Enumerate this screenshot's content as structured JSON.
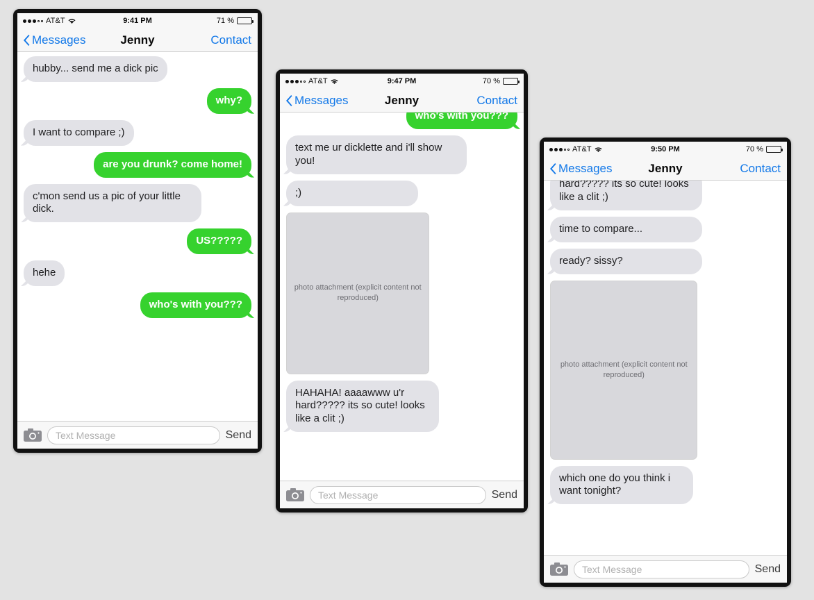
{
  "background_color": "#e3e3e3",
  "colors": {
    "bubble_incoming": "#e2e2e7",
    "bubble_outgoing": "#36d22e",
    "link_blue": "#1278e8",
    "chrome_gray": "#f7f7f7"
  },
  "phones": [
    {
      "id": "phone-1",
      "status_bar": {
        "carrier": "AT&T",
        "signal_dots_filled": 3,
        "signal_dots_hollow": 2,
        "wifi_icon": "wifi-icon",
        "time": "9:41 PM",
        "battery_percent": "71 %",
        "battery_level": 71
      },
      "nav": {
        "back_icon": "chevron-left-icon",
        "back_label": "Messages",
        "title": "Jenny",
        "right_label": "Contact"
      },
      "messages": [
        {
          "side": "in",
          "text": "hubby... send me a dick pic"
        },
        {
          "side": "out",
          "text": "why?"
        },
        {
          "side": "in",
          "text": "I want to compare ;)"
        },
        {
          "side": "out",
          "text": "are you drunk? come home!"
        },
        {
          "side": "in",
          "text": "c'mon send us a pic of your little dick."
        },
        {
          "side": "out",
          "text": "US?????"
        },
        {
          "side": "in",
          "text": "hehe"
        },
        {
          "side": "out",
          "text": "who's with you???"
        }
      ],
      "composer": {
        "camera_icon": "camera-icon",
        "placeholder": "Text Message",
        "send_label": "Send"
      }
    },
    {
      "id": "phone-2",
      "status_bar": {
        "carrier": "AT&T",
        "signal_dots_filled": 3,
        "signal_dots_hollow": 2,
        "wifi_icon": "wifi-icon",
        "time": "9:47 PM",
        "battery_percent": "70 %",
        "battery_level": 70
      },
      "nav": {
        "back_icon": "chevron-left-icon",
        "back_label": "Messages",
        "title": "Jenny",
        "right_label": "Contact"
      },
      "messages": [
        {
          "side": "out",
          "text": "who's with you???",
          "clipped": true
        },
        {
          "side": "in",
          "text": "text me ur dicklette and i'll show you!"
        },
        {
          "side": "in",
          "text": ";)"
        },
        {
          "side": "in",
          "type": "photo",
          "text": "photo attachment (explicit content not reproduced)"
        },
        {
          "side": "in",
          "text": "HAHAHA! aaaawww u'r hard????? its so cute! looks like a clit ;)"
        }
      ],
      "composer": {
        "camera_icon": "camera-icon",
        "placeholder": "Text Message",
        "send_label": "Send"
      }
    },
    {
      "id": "phone-3",
      "status_bar": {
        "carrier": "AT&T",
        "signal_dots_filled": 3,
        "signal_dots_hollow": 2,
        "wifi_icon": "wifi-icon",
        "time": "9:50 PM",
        "battery_percent": "70 %",
        "battery_level": 70
      },
      "nav": {
        "back_icon": "chevron-left-icon",
        "back_label": "Messages",
        "title": "Jenny",
        "right_label": "Contact"
      },
      "messages": [
        {
          "side": "in",
          "text": "hard????? its so cute! looks like a clit ;)",
          "clipped": true
        },
        {
          "side": "in",
          "text": "time to compare..."
        },
        {
          "side": "in",
          "text": "ready? sissy?"
        },
        {
          "side": "in",
          "type": "photo",
          "text": "photo attachment (explicit content not reproduced)"
        },
        {
          "side": "in",
          "text": "which one do you think i want tonight?"
        }
      ],
      "composer": {
        "camera_icon": "camera-icon",
        "placeholder": "Text Message",
        "send_label": "Send"
      }
    }
  ]
}
